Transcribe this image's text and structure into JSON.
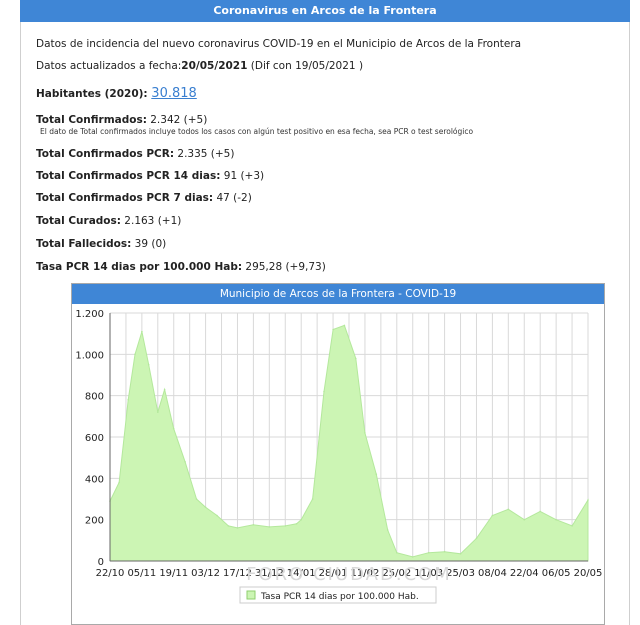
{
  "header": {
    "title": "Coronavirus en Arcos de la Frontera"
  },
  "info": {
    "intro": "Datos de incidencia del nuevo coronavirus COVID-19 en el Municipio de Arcos de la Frontera",
    "updated_label": "Datos actualizados a fecha:",
    "updated_date": "20/05/2021",
    "updated_diff": " (Dif con 19/05/2021 )",
    "population_label": "Habitantes (2020): ",
    "population_value": "30.818",
    "confirmed_label": "Total Confirmados:",
    "confirmed_value": " 2.342 (+5)",
    "confirmed_note": "El dato de Total confirmados incluye todos los casos con algún test positivo en esa fecha, sea PCR o test serológico",
    "pcr_label": "Total Confirmados PCR:",
    "pcr_value": " 2.335 (+5)",
    "pcr14_label": "Total Confirmados PCR 14 dias:",
    "pcr14_value": " 91 (+3)",
    "pcr7_label": "Total Confirmados PCR 7 dias:",
    "pcr7_value": " 47 (-2)",
    "cured_label": "Total Curados:",
    "cured_value": " 2.163 (+1)",
    "deaths_label": "Total Fallecidos:",
    "deaths_value": " 39 (0)",
    "rate_label": "Tasa PCR 14 dias por 100.000 Hab:",
    "rate_value": " 295,28 (+9,73)"
  },
  "colors": {
    "accent": "#3f86d6",
    "area_fill": "#ccf5b4",
    "area_line": "#b4e89c"
  },
  "chart_data": {
    "type": "area",
    "title": "Municipio de Arcos de la Frontera - COVID-19",
    "xlabel": "",
    "ylabel": "",
    "ylim": [
      0,
      1200
    ],
    "yticks": [
      "0",
      "200",
      "400",
      "600",
      "800",
      "1.000",
      "1.200"
    ],
    "xticks": [
      "22/10",
      "05/11",
      "19/11",
      "03/12",
      "17/12",
      "31/12",
      "14/01",
      "28/01",
      "11/02",
      "25/02",
      "11/03",
      "25/03",
      "08/04",
      "22/04",
      "06/05",
      "20/05"
    ],
    "grid": true,
    "legend": "bottom",
    "watermark": "FORO CIUDAD.COM",
    "series": [
      {
        "name": "Tasa PCR 14 dias por 100.000 Hab.",
        "x": [
          "22/10",
          "26/10",
          "30/10",
          "02/11",
          "05/11",
          "08/11",
          "12/11",
          "15/11",
          "19/11",
          "24/11",
          "29/11",
          "03/12",
          "08/12",
          "13/12",
          "17/12",
          "24/12",
          "31/12",
          "07/01",
          "12/01",
          "14/01",
          "19/01",
          "24/01",
          "28/01",
          "02/02",
          "07/02",
          "11/02",
          "16/02",
          "21/02",
          "25/02",
          "04/03",
          "11/03",
          "18/03",
          "25/03",
          "01/04",
          "08/04",
          "15/04",
          "22/04",
          "29/04",
          "06/05",
          "13/05",
          "20/05"
        ],
        "values": [
          290,
          380,
          780,
          1000,
          1110,
          950,
          720,
          830,
          640,
          480,
          300,
          260,
          220,
          170,
          160,
          175,
          165,
          170,
          180,
          200,
          300,
          820,
          1120,
          1140,
          980,
          620,
          420,
          150,
          40,
          20,
          40,
          45,
          35,
          110,
          220,
          250,
          200,
          240,
          200,
          170,
          295
        ]
      }
    ]
  }
}
